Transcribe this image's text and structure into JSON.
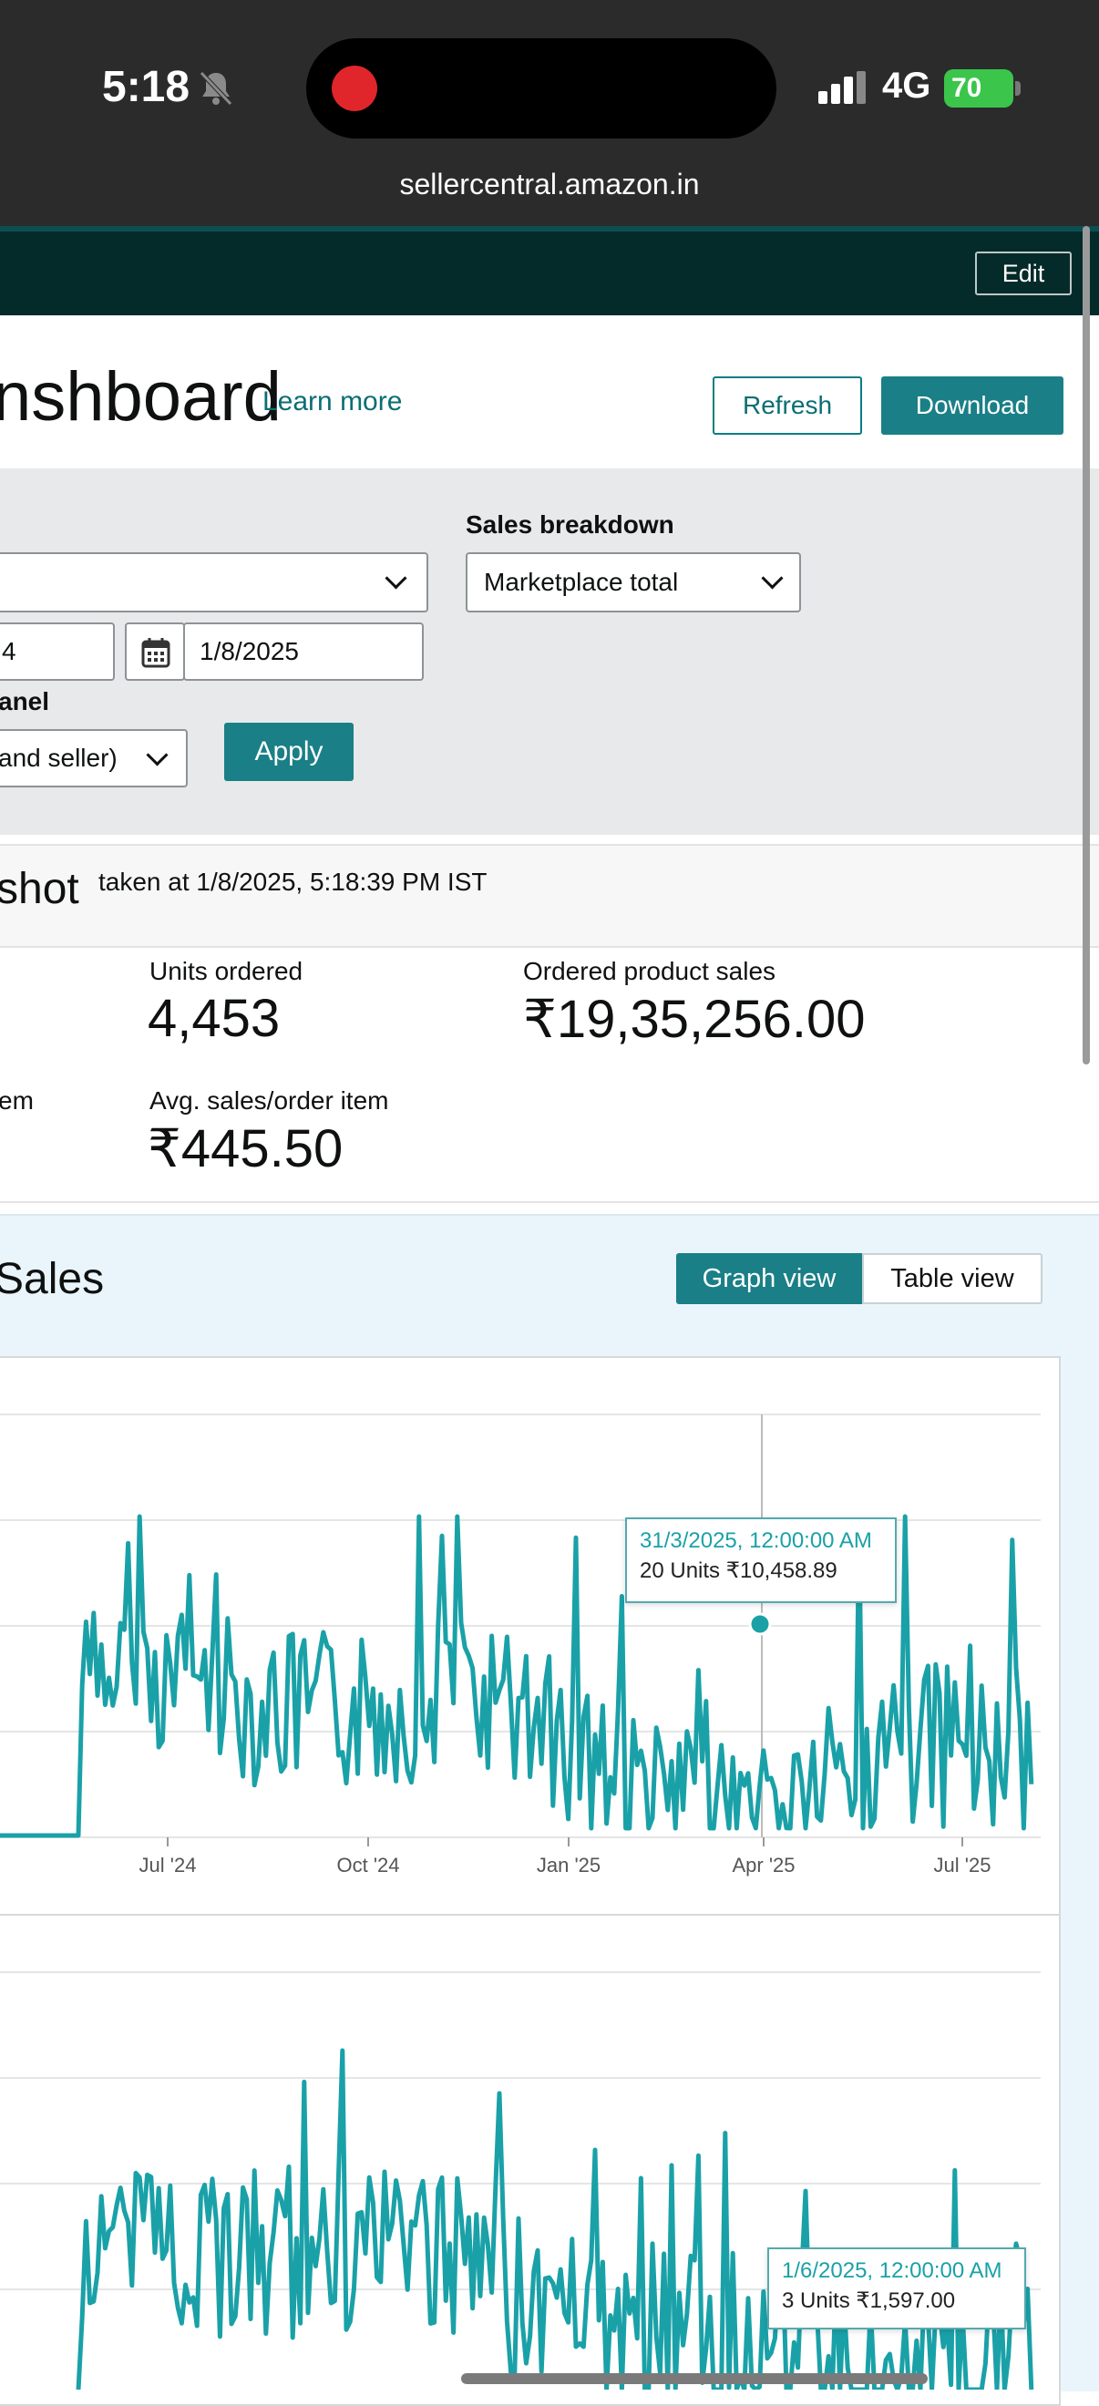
{
  "status_bar": {
    "time": "5:18",
    "network": "4G",
    "battery": "70"
  },
  "browser": {
    "url": "sellercentral.amazon.in"
  },
  "nav": {
    "edit_label": "Edit"
  },
  "header": {
    "title": "nshboard",
    "learn_more": "Learn more",
    "refresh_label": "Refresh",
    "download_label": "Download"
  },
  "filters": {
    "sales_breakdown_label": "Sales breakdown",
    "sales_breakdown_value": "Marketplace total",
    "start_date_partial": "4",
    "end_date": "1/8/2025",
    "channel_label_partial": "anel",
    "channel_value_partial": "and seller)",
    "apply_label": "Apply"
  },
  "snapshot": {
    "title_partial": "shot",
    "taken_at": "taken at 1/8/2025, 5:18:39 PM IST",
    "metrics": [
      {
        "label": "Units ordered",
        "value": "4,453"
      },
      {
        "label": "Ordered product sales",
        "value": "₹19,35,256.00"
      },
      {
        "label": "em",
        "value": ""
      },
      {
        "label": "Avg. sales/order item",
        "value": "₹445.50"
      }
    ]
  },
  "sales": {
    "title_partial": "Sales",
    "graph_view_label": "Graph view",
    "table_view_label": "Table view"
  },
  "chart_data": [
    {
      "type": "line",
      "x_ticks": [
        "Jul '24",
        "Oct '24",
        "Jan '25",
        "Apr '25",
        "Jul '25"
      ],
      "series": [
        {
          "color": "#1aa1a8"
        }
      ],
      "tooltip": {
        "date": "31/3/2025, 12:00:00 AM",
        "value": "20 Units ₹10,458.89"
      },
      "grid": true
    },
    {
      "type": "line",
      "series": [
        {
          "color": "#1aa1a8"
        }
      ],
      "tooltip": {
        "date": "1/6/2025, 12:00:00 AM",
        "value": "3 Units ₹1,597.00"
      },
      "grid": true
    }
  ]
}
